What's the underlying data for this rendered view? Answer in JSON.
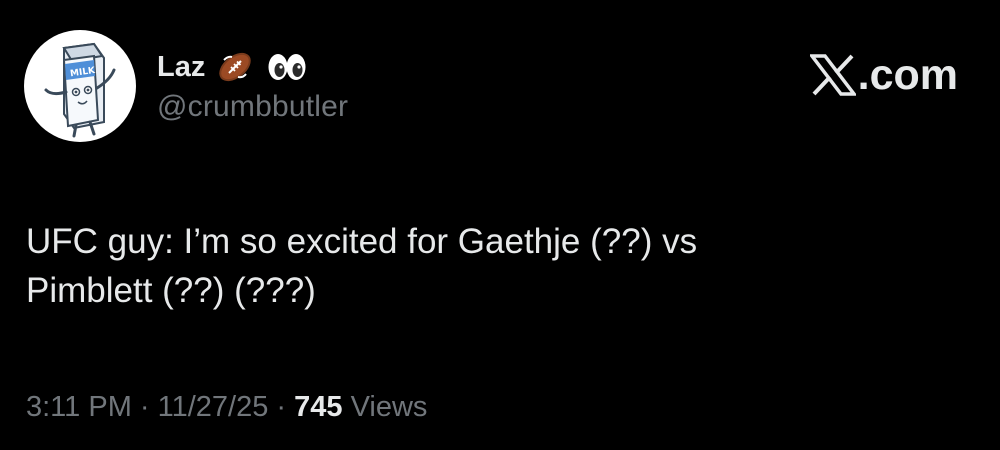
{
  "user": {
    "display_name": "Laz",
    "handle": "@crumbbutler",
    "avatar_icon": "milk-carton-avatar",
    "avatar_text": "MILK",
    "name_emojis": [
      "american-football-icon",
      "eyes-icon"
    ]
  },
  "brand": {
    "text": ".com",
    "icon": "x-logo-icon"
  },
  "tweet": {
    "lines": [
      "UFC guy: I’m so excited for Gaethje (??) vs",
      "Pimblett (??) (???)"
    ]
  },
  "meta": {
    "time": "3:11 PM",
    "separator": " · ",
    "date": "11/27/25",
    "views_count": "745",
    "views_label": " Views"
  },
  "colors": {
    "background": "#000000",
    "primary_text": "#e7e9ea",
    "secondary_text": "#71767b"
  }
}
